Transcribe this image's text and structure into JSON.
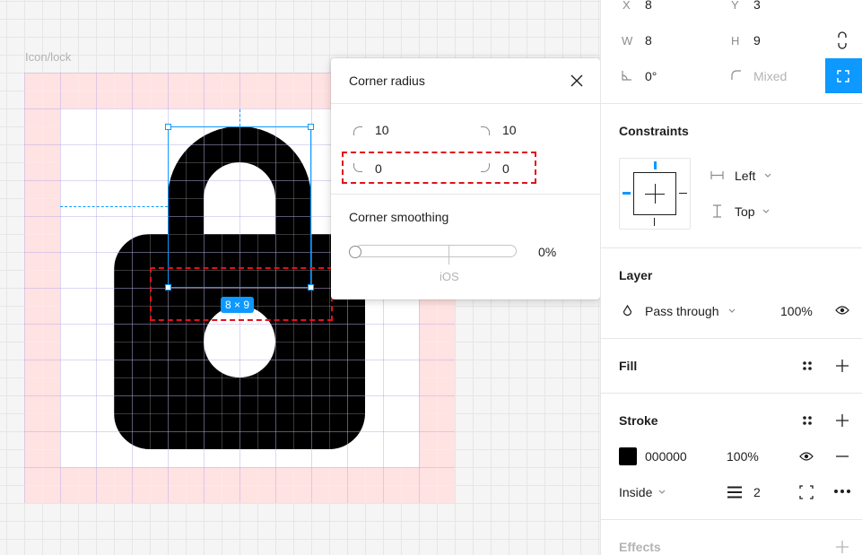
{
  "canvas": {
    "frame_label": "Icon/lock",
    "dimension_badge": "8 × 9"
  },
  "popover": {
    "title": "Corner radius",
    "radius_top_left": "10",
    "radius_top_right": "10",
    "radius_bottom_left": "0",
    "radius_bottom_right": "0",
    "smoothing_title": "Corner smoothing",
    "smoothing_value": "0%",
    "smoothing_marker_label": "iOS",
    "smoothing_fraction": 0
  },
  "panel": {
    "x_label": "X",
    "x_value": "8",
    "y_label": "Y",
    "y_value": "3",
    "w_label": "W",
    "w_value": "8",
    "h_label": "H",
    "h_value": "9",
    "rotation_value": "0°",
    "corner_value": "Mixed",
    "constraints_title": "Constraints",
    "constraint_horizontal": "Left",
    "constraint_vertical": "Top",
    "layer_title": "Layer",
    "blend_mode": "Pass through",
    "layer_opacity": "100%",
    "fill_title": "Fill",
    "stroke_title": "Stroke",
    "stroke_color_hex": "000000",
    "stroke_opacity": "100%",
    "stroke_position": "Inside",
    "stroke_weight": "2",
    "effects_title": "Effects"
  },
  "colors": {
    "accent": "#0d99ff",
    "highlight": "#e0121b",
    "stroke_swatch": "#000000"
  }
}
